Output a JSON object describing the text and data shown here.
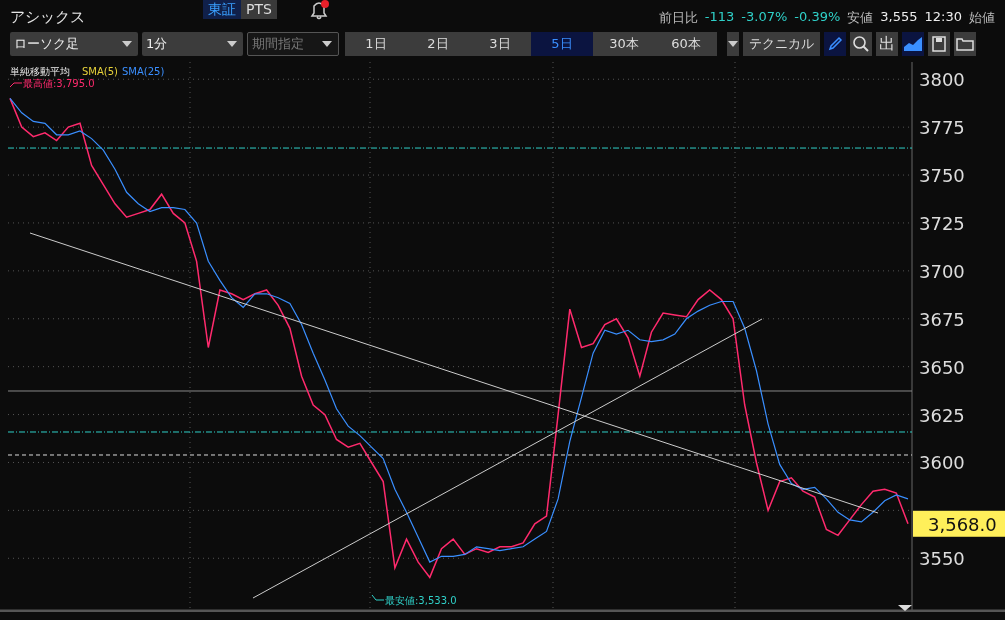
{
  "stock_name": "アシックス",
  "market_tabs": [
    {
      "label": "東証",
      "selected": true
    },
    {
      "label": "PTS",
      "selected": false
    }
  ],
  "quote": {
    "change_label": "前日比",
    "change": "-113",
    "change_pct": "-3.07%",
    "change_pct_2": "-0.39%",
    "low_label": "安値",
    "low": "3,555",
    "time": "12:30",
    "open_label": "始値"
  },
  "toolbar": {
    "chart_type": "ローソク足",
    "interval": "1分",
    "range": {
      "label": "期間指定",
      "disabled": true
    },
    "periods": [
      {
        "label": "1日",
        "selected": false
      },
      {
        "label": "2日",
        "selected": false
      },
      {
        "label": "3日",
        "selected": false
      },
      {
        "label": "5日",
        "selected": true
      },
      {
        "label": "30本",
        "selected": false
      },
      {
        "label": "60本",
        "selected": false
      }
    ],
    "technical": "テクニカル",
    "draw_tool": {
      "selected": true
    },
    "export_label": "出",
    "chart_style": {
      "selected": true
    }
  },
  "chart": {
    "legend": {
      "title": "単純移動平均",
      "series": [
        {
          "name": "SMA(5)",
          "color": "#e8d33a"
        }
      ]
    },
    "high_label": "最高値:3,795.0",
    "low_label": "最安値:3,533.0",
    "last_price": "3,568.0",
    "chart_data": {
      "type": "line",
      "grid": true,
      "ylim": [
        3523,
        3809
      ],
      "ref_lines": [
        {
          "axis": "y",
          "value": 3764.1,
          "color": "#2fd0c8"
        },
        {
          "axis": "y",
          "value": 3637.3,
          "color": "#888888"
        },
        {
          "axis": "y",
          "value": 3615.9,
          "color": "#2fd0c8"
        },
        {
          "axis": "y",
          "value": 3603.9,
          "color": "#dddddd"
        }
      ],
      "yticks": [
        3550,
        3600,
        3625,
        3650,
        3675,
        3700,
        3725,
        3750,
        3775,
        3800
      ],
      "series": [
        {
          "color": "#ff2a6d",
          "values": [
            3790,
            3775,
            3770,
            3772,
            3768,
            3775,
            3777,
            3755,
            3745,
            3735,
            3728,
            3730,
            3732,
            3740,
            3730,
            3725,
            3705,
            3660,
            3690,
            3688,
            3685,
            3688,
            3690,
            3682,
            3670,
            3645,
            3630,
            3625,
            3612,
            3608,
            3610,
            3600,
            3590,
            3545,
            3560,
            3548,
            3540,
            3555,
            3560,
            3552,
            3555,
            3553,
            3556,
            3556,
            3558,
            3568,
            3572,
            3625,
            3680,
            3660,
            3662,
            3672,
            3675,
            3665,
            3645,
            3668,
            3678,
            3677,
            3676,
            3685,
            3690,
            3685,
            3675,
            3630,
            3600,
            3575,
            3590,
            3592,
            3585,
            3582,
            3565,
            3562,
            3570,
            3578,
            3585,
            3586,
            3584,
            3568
          ]
        },
        {
          "name": "SMA(25)",
          "color": "#3a8fff",
          "values": [
            3790,
            3782.5,
            3778,
            3777,
            3771,
            3771,
            3773,
            3769,
            3763,
            3753,
            3741,
            3735,
            3731,
            3733,
            3733,
            3732,
            3725,
            3705,
            3695,
            3686,
            3681,
            3688,
            3688,
            3686,
            3683,
            3672,
            3657,
            3643,
            3628,
            3619,
            3614,
            3608,
            3602,
            3586,
            3574,
            3561,
            3548,
            3551,
            3551,
            3552,
            3556,
            3555,
            3554,
            3555,
            3556,
            3560,
            3564,
            3581,
            3611,
            3634,
            3657,
            3669,
            3667,
            3669,
            3664,
            3663,
            3664,
            3667,
            3675,
            3679,
            3682,
            3684,
            3684,
            3670,
            3648,
            3620,
            3599,
            3589,
            3586,
            3587,
            3581,
            3574,
            3570,
            3569,
            3574,
            3580,
            3583,
            3581
          ]
        }
      ]
    }
  }
}
